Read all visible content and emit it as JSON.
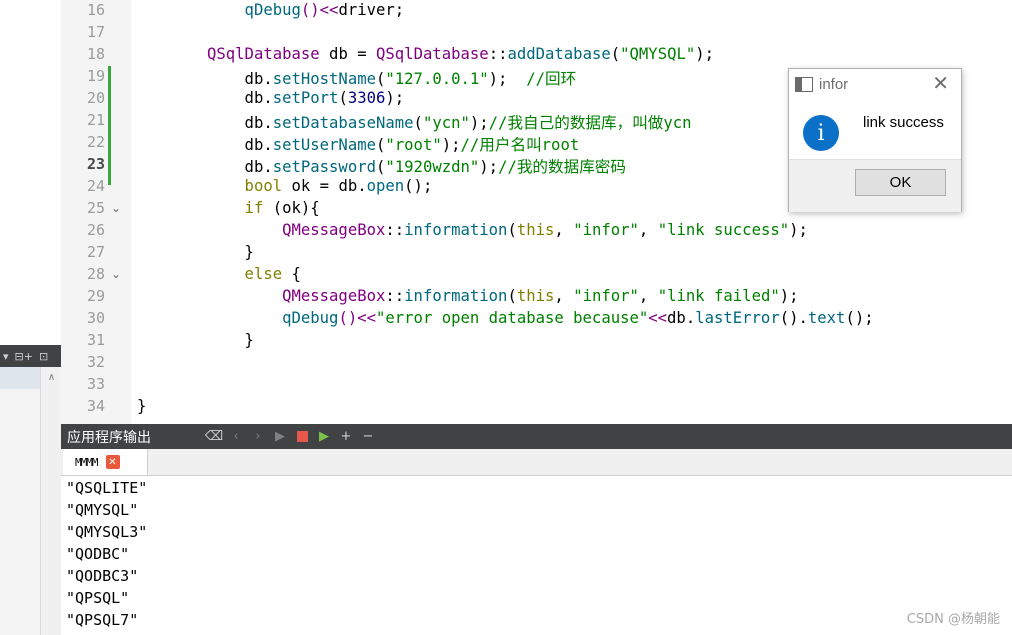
{
  "editor": {
    "line_numbers": [
      "16",
      "17",
      "18",
      "19",
      "20",
      "21",
      "22",
      "23",
      "24",
      "25",
      "26",
      "27",
      "28",
      "29",
      "30",
      "31",
      "32",
      "33",
      "34"
    ],
    "current_line": "23",
    "lines": [
      [
        {
          "t": "    qDebug",
          "c": "mf"
        },
        {
          "t": "()<<",
          "c": "cn"
        },
        {
          "t": "driver;",
          "c": ""
        }
      ],
      [],
      [
        {
          "t": "QSqlDatabase",
          "c": "cn"
        },
        {
          "t": " db = ",
          "c": ""
        },
        {
          "t": "QSqlDatabase",
          "c": "cn"
        },
        {
          "t": "::",
          "c": ""
        },
        {
          "t": "addDatabase",
          "c": "mf"
        },
        {
          "t": "(",
          "c": ""
        },
        {
          "t": "\"QMYSQL\"",
          "c": "st"
        },
        {
          "t": ");",
          "c": ""
        }
      ],
      [
        {
          "t": "    db.",
          "c": ""
        },
        {
          "t": "setHostName",
          "c": "mf"
        },
        {
          "t": "(",
          "c": ""
        },
        {
          "t": "\"127.0.0.1\"",
          "c": "st"
        },
        {
          "t": ");  ",
          "c": ""
        },
        {
          "t": "//回环",
          "c": "cm"
        }
      ],
      [
        {
          "t": "    db.",
          "c": ""
        },
        {
          "t": "setPort",
          "c": "mf"
        },
        {
          "t": "(",
          "c": ""
        },
        {
          "t": "3306",
          "c": "nm"
        },
        {
          "t": ");",
          "c": ""
        }
      ],
      [
        {
          "t": "    db.",
          "c": ""
        },
        {
          "t": "setDatabaseName",
          "c": "mf"
        },
        {
          "t": "(",
          "c": ""
        },
        {
          "t": "\"ycn\"",
          "c": "st"
        },
        {
          "t": ");",
          "c": ""
        },
        {
          "t": "//我自己的数据库，叫做ycn",
          "c": "cm"
        }
      ],
      [
        {
          "t": "    db.",
          "c": ""
        },
        {
          "t": "setUserName",
          "c": "mf"
        },
        {
          "t": "(",
          "c": ""
        },
        {
          "t": "\"root\"",
          "c": "st"
        },
        {
          "t": ");",
          "c": ""
        },
        {
          "t": "//用户名叫root",
          "c": "cm"
        }
      ],
      [
        {
          "t": "    db.",
          "c": ""
        },
        {
          "t": "setPassword",
          "c": "mf"
        },
        {
          "t": "(",
          "c": ""
        },
        {
          "t": "\"1920wzdn\"",
          "c": "st"
        },
        {
          "t": ");",
          "c": ""
        },
        {
          "t": "//我的数据库密码",
          "c": "cm"
        }
      ],
      [
        {
          "t": "    bool",
          "c": "kw"
        },
        {
          "t": " ok = db.",
          "c": ""
        },
        {
          "t": "open",
          "c": "mf"
        },
        {
          "t": "();",
          "c": ""
        }
      ],
      [
        {
          "t": "    if",
          "c": "kw"
        },
        {
          "t": " (ok){",
          "c": ""
        }
      ],
      [
        {
          "t": "        QMessageBox",
          "c": "cn"
        },
        {
          "t": "::",
          "c": ""
        },
        {
          "t": "information",
          "c": "mf"
        },
        {
          "t": "(",
          "c": ""
        },
        {
          "t": "this",
          "c": "kw"
        },
        {
          "t": ", ",
          "c": ""
        },
        {
          "t": "\"infor\"",
          "c": "st"
        },
        {
          "t": ", ",
          "c": ""
        },
        {
          "t": "\"link success\"",
          "c": "st"
        },
        {
          "t": ");",
          "c": ""
        }
      ],
      [
        {
          "t": "    }",
          "c": ""
        }
      ],
      [
        {
          "t": "    else",
          "c": "kw"
        },
        {
          "t": " {",
          "c": ""
        }
      ],
      [
        {
          "t": "        QMessageBox",
          "c": "cn"
        },
        {
          "t": "::",
          "c": ""
        },
        {
          "t": "information",
          "c": "mf"
        },
        {
          "t": "(",
          "c": ""
        },
        {
          "t": "this",
          "c": "kw"
        },
        {
          "t": ", ",
          "c": ""
        },
        {
          "t": "\"infor\"",
          "c": "st"
        },
        {
          "t": ", ",
          "c": ""
        },
        {
          "t": "\"link failed\"",
          "c": "st"
        },
        {
          "t": ");",
          "c": ""
        }
      ],
      [
        {
          "t": "        qDebug",
          "c": "mf"
        },
        {
          "t": "()<<",
          "c": "cn"
        },
        {
          "t": "\"error open database because\"",
          "c": "st"
        },
        {
          "t": "<<",
          "c": "cn"
        },
        {
          "t": "db.",
          "c": ""
        },
        {
          "t": "lastError",
          "c": "mf"
        },
        {
          "t": "().",
          "c": ""
        },
        {
          "t": "text",
          "c": "mf"
        },
        {
          "t": "();",
          "c": ""
        }
      ],
      [
        {
          "t": "    }",
          "c": ""
        }
      ],
      [],
      [],
      [
        {
          "t": "}",
          "c": ""
        }
      ]
    ],
    "fold_lines": [
      "25",
      "28"
    ],
    "fold_icon": "chevron-down-icon"
  },
  "output": {
    "title": "应用程序输出",
    "tab_label": "MMMM",
    "lines": [
      "\"QSQLITE\"",
      "\"QMYSQL\"",
      "\"QMYSQL3\"",
      "\"QODBC\"",
      "\"QODBC3\"",
      "\"QPSQL\"",
      "\"QPSQL7\""
    ]
  },
  "dialog": {
    "title": "infor",
    "message": "link success",
    "ok_label": "OK",
    "info_glyph": "i"
  },
  "watermark": "CSDN @杨朝能",
  "colors": {
    "editor_bg": "#ffffff",
    "gutter_bg": "#f4f4f4",
    "panel_dark": "#404244",
    "class_purple": "#800080",
    "method_teal": "#00677c",
    "string_green": "#008000",
    "keyword_olive": "#808000",
    "info_blue": "#0a70c8"
  }
}
